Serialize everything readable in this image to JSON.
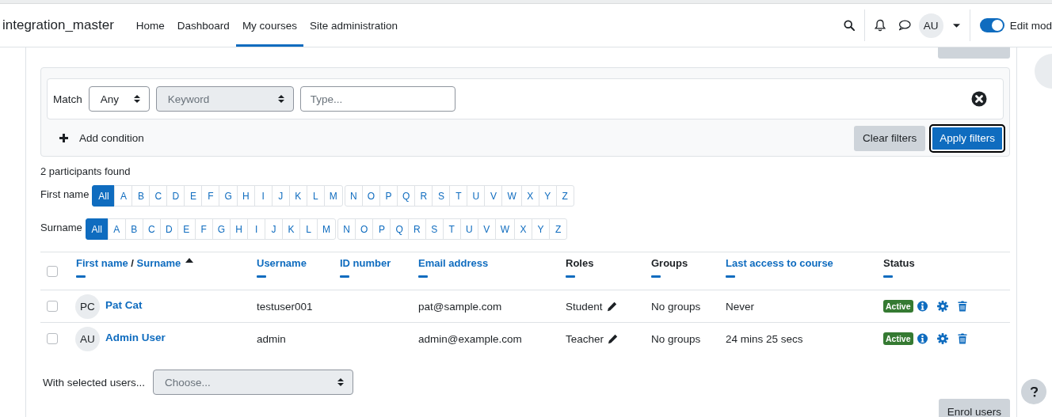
{
  "header": {
    "site_name": "integration_master",
    "nav": [
      {
        "label": "Home",
        "selected": false
      },
      {
        "label": "Dashboard",
        "selected": false
      },
      {
        "label": "My courses",
        "selected": true
      },
      {
        "label": "Site administration",
        "selected": false
      }
    ],
    "avatar": "AU",
    "edit_mode": {
      "label": "Edit mod",
      "on": true
    }
  },
  "filter": {
    "match_label": "Match",
    "match_value": "Any",
    "field": "Keyword",
    "placeholder": "Type...",
    "add_condition": "Add condition",
    "buttons": [
      {
        "label": "Clear filters",
        "kind": "secondary"
      },
      {
        "label": "Apply filters",
        "kind": "primary"
      }
    ]
  },
  "count": "2 participants found",
  "initials_bars": [
    {
      "label": "First name",
      "letters": [
        {
          "text": "All",
          "selected": true
        },
        {
          "text": "A",
          "selected": false
        },
        {
          "text": "B",
          "selected": false
        },
        {
          "text": "C",
          "selected": false
        },
        {
          "text": "D",
          "selected": false
        },
        {
          "text": "E",
          "selected": false
        },
        {
          "text": "F",
          "selected": false
        },
        {
          "text": "G",
          "selected": false
        },
        {
          "text": "H",
          "selected": false
        },
        {
          "text": "I",
          "selected": false
        },
        {
          "text": "J",
          "selected": false
        },
        {
          "text": "K",
          "selected": false
        },
        {
          "text": "L",
          "selected": false
        },
        {
          "text": "M",
          "selected": false
        },
        {
          "text": "N",
          "selected": false
        },
        {
          "text": "O",
          "selected": false
        },
        {
          "text": "P",
          "selected": false
        },
        {
          "text": "Q",
          "selected": false
        },
        {
          "text": "R",
          "selected": false
        },
        {
          "text": "S",
          "selected": false
        },
        {
          "text": "T",
          "selected": false
        },
        {
          "text": "U",
          "selected": false
        },
        {
          "text": "V",
          "selected": false
        },
        {
          "text": "W",
          "selected": false
        },
        {
          "text": "X",
          "selected": false
        },
        {
          "text": "Y",
          "selected": false
        },
        {
          "text": "Z",
          "selected": false
        }
      ]
    },
    {
      "label": "Surname",
      "letters": [
        {
          "text": "All",
          "selected": true
        },
        {
          "text": "A",
          "selected": false
        },
        {
          "text": "B",
          "selected": false
        },
        {
          "text": "C",
          "selected": false
        },
        {
          "text": "D",
          "selected": false
        },
        {
          "text": "E",
          "selected": false
        },
        {
          "text": "F",
          "selected": false
        },
        {
          "text": "G",
          "selected": false
        },
        {
          "text": "H",
          "selected": false
        },
        {
          "text": "I",
          "selected": false
        },
        {
          "text": "J",
          "selected": false
        },
        {
          "text": "K",
          "selected": false
        },
        {
          "text": "L",
          "selected": false
        },
        {
          "text": "M",
          "selected": false
        },
        {
          "text": "N",
          "selected": false
        },
        {
          "text": "O",
          "selected": false
        },
        {
          "text": "P",
          "selected": false
        },
        {
          "text": "Q",
          "selected": false
        },
        {
          "text": "R",
          "selected": false
        },
        {
          "text": "S",
          "selected": false
        },
        {
          "text": "T",
          "selected": false
        },
        {
          "text": "U",
          "selected": false
        },
        {
          "text": "V",
          "selected": false
        },
        {
          "text": "W",
          "selected": false
        },
        {
          "text": "X",
          "selected": false
        },
        {
          "text": "Y",
          "selected": false
        },
        {
          "text": "Z",
          "selected": false
        }
      ]
    }
  ],
  "table": {
    "header_checked": false,
    "columns": [
      {
        "labels": [
          "First name",
          "Surname"
        ],
        "separator": "/",
        "sortable": true,
        "sorted": true
      },
      {
        "label": "Username",
        "sortable": true,
        "sorted": false
      },
      {
        "label": "ID number",
        "sortable": true,
        "sorted": false
      },
      {
        "label": "Email address",
        "sortable": true,
        "sorted": false
      },
      {
        "label": "Roles",
        "sortable": false,
        "sorted": false
      },
      {
        "label": "Groups",
        "sortable": false,
        "sorted": false
      },
      {
        "label": "Last access to course",
        "sortable": true,
        "sorted": false
      },
      {
        "label": "Status",
        "sortable": false,
        "sorted": false
      }
    ],
    "rows": [
      {
        "checked": false,
        "initials": "PC",
        "name": "Pat Cat",
        "username": "testuser001",
        "email": "pat@sample.com",
        "role": "Student",
        "groups": "No groups",
        "last_access": "Never",
        "status": "Active"
      },
      {
        "checked": false,
        "initials": "AU",
        "name": "Admin User",
        "username": "admin",
        "email": "admin@example.com",
        "role": "Teacher",
        "groups": "No groups",
        "last_access": "24 mins 25 secs",
        "status": "Active"
      }
    ]
  },
  "bulk": {
    "label": "With selected users...",
    "placeholder": "Choose..."
  },
  "bottom_button": "Enrol users"
}
